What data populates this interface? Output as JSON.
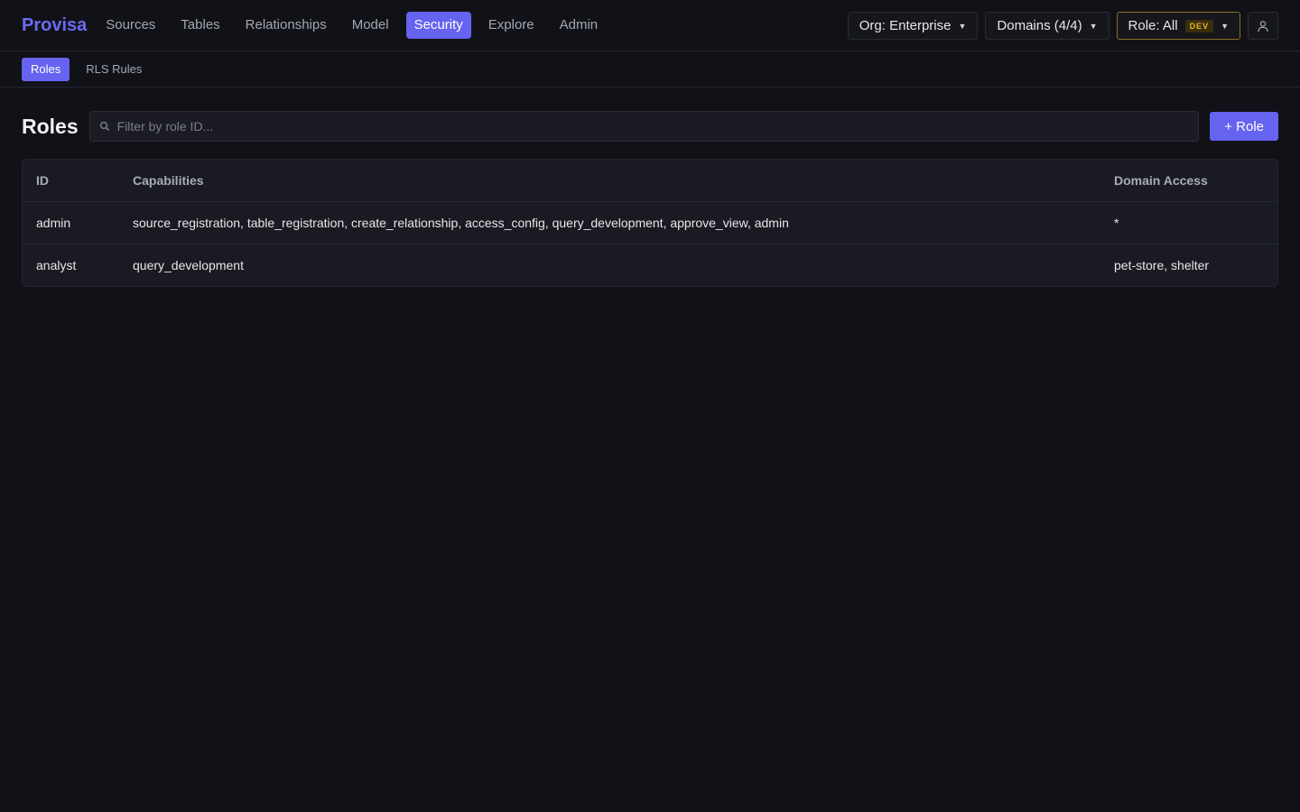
{
  "brand": "Provisa",
  "nav": [
    {
      "label": "Sources",
      "active": false
    },
    {
      "label": "Tables",
      "active": false
    },
    {
      "label": "Relationships",
      "active": false
    },
    {
      "label": "Model",
      "active": false
    },
    {
      "label": "Security",
      "active": true
    },
    {
      "label": "Explore",
      "active": false
    },
    {
      "label": "Admin",
      "active": false
    }
  ],
  "top_right": {
    "org": "Org: Enterprise",
    "domains": "Domains (4/4)",
    "role": "Role: All",
    "role_badge": "DEV",
    "user_icon": "user-icon"
  },
  "subnav": [
    {
      "label": "Roles",
      "active": true
    },
    {
      "label": "RLS Rules",
      "active": false
    }
  ],
  "main": {
    "title": "Roles",
    "search_placeholder": "Filter by role ID...",
    "search_value": "",
    "add_button": "+ Role"
  },
  "table": {
    "columns": [
      "ID",
      "Capabilities",
      "Domain Access"
    ],
    "rows": [
      {
        "id": "admin",
        "capabilities": "source_registration, table_registration, create_relationship, access_config, query_development, approve_view, admin",
        "domain_access": "*"
      },
      {
        "id": "analyst",
        "capabilities": "query_development",
        "domain_access": "pet-store, shelter"
      }
    ]
  },
  "colors": {
    "accent": "#6563f0",
    "background": "#111218",
    "dev_badge": "#e3b52a"
  }
}
